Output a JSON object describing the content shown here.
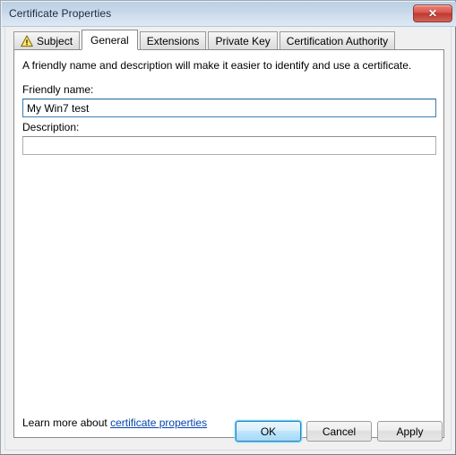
{
  "window": {
    "title": "Certificate Properties",
    "close_label": "✕",
    "close_icon": "close-icon"
  },
  "tabs": [
    {
      "label": "Subject",
      "icon": "warning-triangle-icon",
      "active": false
    },
    {
      "label": "General",
      "icon": null,
      "active": true
    },
    {
      "label": "Extensions",
      "icon": null,
      "active": false
    },
    {
      "label": "Private Key",
      "icon": null,
      "active": false
    },
    {
      "label": "Certification Authority",
      "icon": null,
      "active": false
    }
  ],
  "general": {
    "intro": "A friendly name and description will make it easier to identify and use a certificate.",
    "friendly_name_label": "Friendly name:",
    "friendly_name_value": "My Win7 test",
    "friendly_name_placeholder": "",
    "description_label": "Description:",
    "description_value": "",
    "description_placeholder": "",
    "learn_more_prefix": "Learn more about ",
    "learn_more_link": "certificate properties"
  },
  "buttons": {
    "ok": "OK",
    "cancel": "Cancel",
    "apply": "Apply"
  },
  "colors": {
    "titlebar_top": "#bcd0e4",
    "titlebar_bottom": "#dbe8f4",
    "close_red": "#bf372d",
    "link_blue": "#0645ad",
    "focus_blue": "#3c7fb1",
    "warning_yellow": "#ffd94a",
    "dialog_gray": "#f0f0f0"
  }
}
